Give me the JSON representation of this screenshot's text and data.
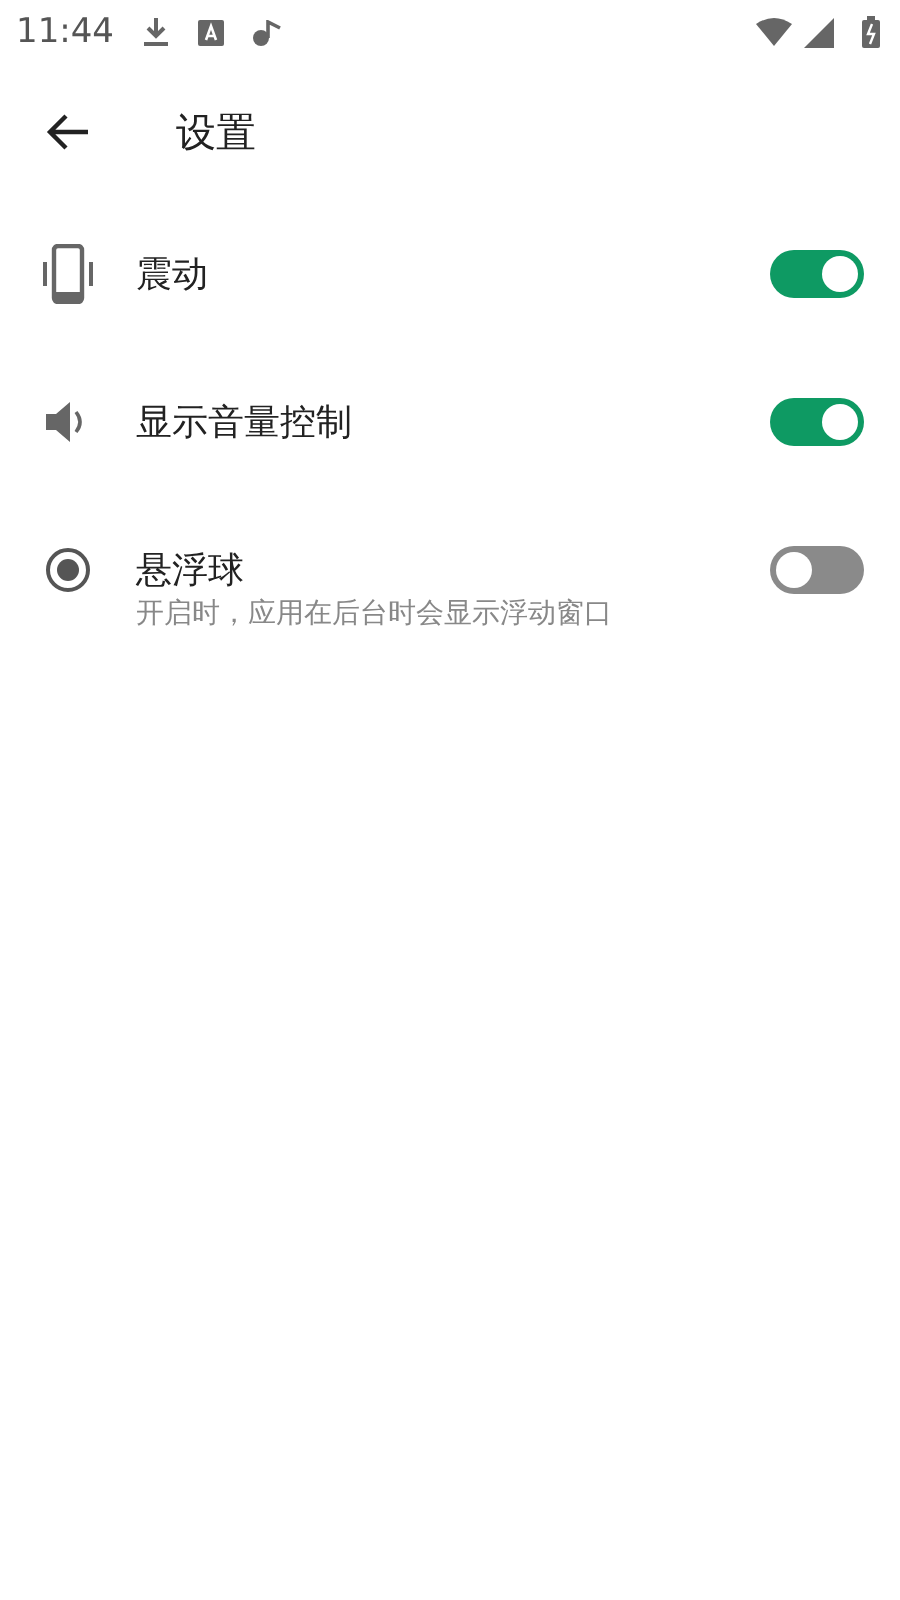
{
  "status_bar": {
    "time": "11:44"
  },
  "header": {
    "title": "设置"
  },
  "settings": [
    {
      "label": "震动",
      "on": true
    },
    {
      "label": "显示音量控制",
      "on": true
    },
    {
      "label": "悬浮球",
      "on": false,
      "description": "开启时，应用在后台时会显示浮动窗口"
    }
  ]
}
